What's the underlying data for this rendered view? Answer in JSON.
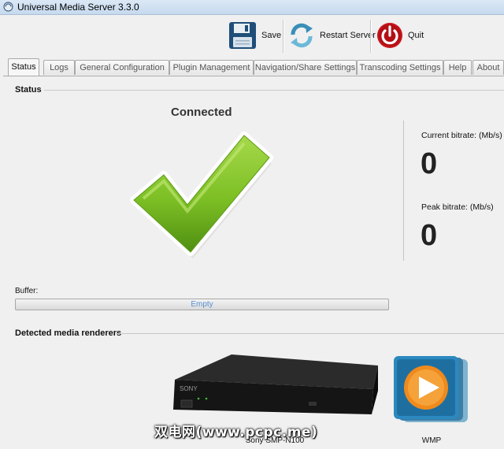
{
  "window": {
    "title": "Universal Media Server 3.3.0"
  },
  "toolbar": {
    "save_label": "Save",
    "restart_label": "Restart Server",
    "quit_label": "Quit"
  },
  "tabs": [
    {
      "label": "Status",
      "active": true
    },
    {
      "label": "Logs"
    },
    {
      "label": "General Configuration"
    },
    {
      "label": "Plugin Management"
    },
    {
      "label": "Navigation/Share Settings"
    },
    {
      "label": "Transcoding Settings"
    },
    {
      "label": "Help"
    },
    {
      "label": "About"
    }
  ],
  "status": {
    "section_title": "Status",
    "state_text": "Connected",
    "current_bitrate_label": "Current bitrate: (Mb/s)",
    "current_bitrate_value": "0",
    "peak_bitrate_label": "Peak bitrate: (Mb/s)",
    "peak_bitrate_value": "0",
    "buffer_label": "Buffer:",
    "buffer_text": "Empty",
    "buffer_fraction": 0.0
  },
  "renderers": {
    "section_title": "Detected media renderers",
    "items": [
      {
        "name": "Sony SMP-N100",
        "icon": "sony-player-icon"
      },
      {
        "name": "WMP",
        "icon": "windows-media-player-icon"
      }
    ]
  },
  "watermark": "双电网(www.pcpc.me)",
  "colors": {
    "check_green": "#7cbf24",
    "wmp_orange": "#f08a1c",
    "quit_red": "#c8161d",
    "save_blue": "#1f4e79"
  }
}
